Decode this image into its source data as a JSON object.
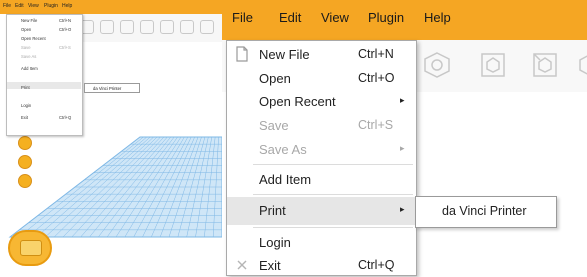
{
  "menubar": {
    "items": [
      {
        "label": "File"
      },
      {
        "label": "Edit"
      },
      {
        "label": "View"
      },
      {
        "label": "Plugin"
      },
      {
        "label": "Help"
      }
    ]
  },
  "file_menu": {
    "items": [
      {
        "label": "New File",
        "shortcut": "Ctrl+N",
        "enabled": true
      },
      {
        "label": "Open",
        "shortcut": "Ctrl+O",
        "enabled": true
      },
      {
        "label": "Open Recent",
        "submenu": true,
        "enabled": true
      },
      {
        "label": "Save",
        "shortcut": "Ctrl+S",
        "enabled": false
      },
      {
        "label": "Save As",
        "submenu": true,
        "enabled": false
      },
      {
        "label": "Add Item",
        "enabled": true
      },
      {
        "label": "Print",
        "submenu": true,
        "enabled": true,
        "highlighted": true
      },
      {
        "label": "Login",
        "enabled": true
      },
      {
        "label": "Exit",
        "shortcut": "Ctrl+Q",
        "enabled": true
      }
    ]
  },
  "print_submenu": {
    "items": [
      {
        "label": "da Vinci Printer"
      }
    ]
  },
  "arrow_glyph": "▸",
  "colors": {
    "menubar_bg": "#f5a623",
    "grid_line": "#7fb8e6",
    "highlight_bg": "#e6e6e6",
    "disabled_text": "#a8a8a8"
  }
}
